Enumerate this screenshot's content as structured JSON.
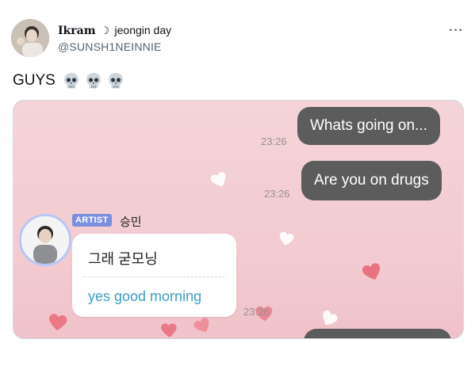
{
  "tweet": {
    "display_name": "Ikram",
    "name_moon": "☽",
    "name_suffix": "jeongin day",
    "handle": "@SUNSH1NEINNIE",
    "more_icon": "···",
    "text": "GUYS",
    "emojis": [
      "skull-icon",
      "skull-icon",
      "skull-icon"
    ]
  },
  "chat": {
    "messages_sent": [
      {
        "text": "Whats going on...",
        "time": "23:26"
      },
      {
        "text": "Are you on drugs",
        "time": "23:26"
      }
    ],
    "artist": {
      "badge": "ARTIST",
      "name": "승민",
      "message_korean": "그래 굳모닝",
      "message_english": "yes good morning",
      "time": "23:26"
    }
  },
  "colors": {
    "chat_background": "#f2ccd1",
    "sent_bubble": "#5c5c5c",
    "artist_badge": "#7a8fe0",
    "translation_text": "#3aa0c8"
  }
}
